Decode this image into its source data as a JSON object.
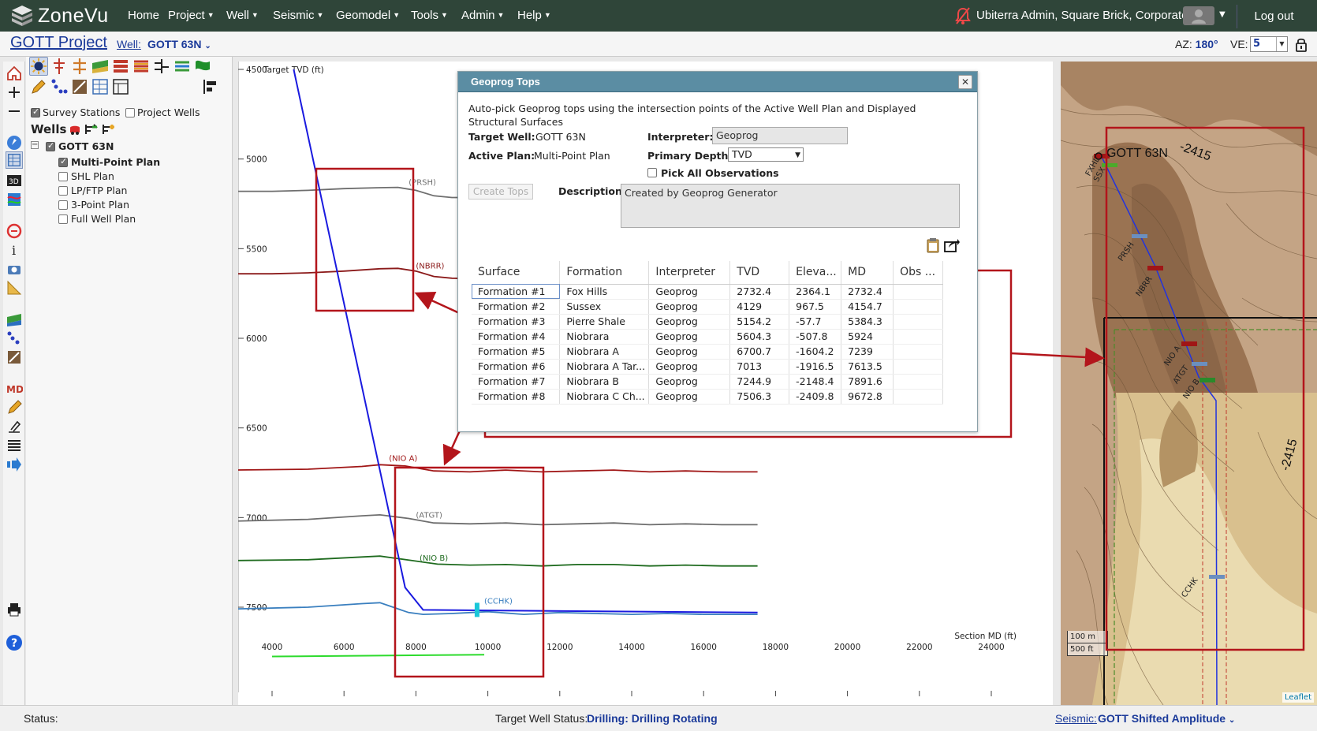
{
  "app": {
    "logo_text": "ZoneVu",
    "nav": [
      {
        "label": "Home",
        "has_menu": false
      },
      {
        "label": "Project",
        "has_menu": true
      },
      {
        "label": "Well",
        "has_menu": true
      },
      {
        "label": "Seismic",
        "has_menu": true
      },
      {
        "label": "Geomodel",
        "has_menu": true
      },
      {
        "label": "Tools",
        "has_menu": true
      },
      {
        "label": "Admin",
        "has_menu": true
      },
      {
        "label": "Help",
        "has_menu": true
      }
    ],
    "user": "Ubiterra Admin, Square Brick, Corporate",
    "logout": "Log out"
  },
  "project_bar": {
    "title": "GOTT Project",
    "well_label": "Well:",
    "well_value": "GOTT 63N",
    "az_label": "AZ:",
    "az_value": "180°",
    "ve_label": "VE:",
    "ve_value": "5"
  },
  "left_panel": {
    "survey_stations": {
      "label": "Survey Stations",
      "checked": true
    },
    "project_wells": {
      "label": "Project Wells",
      "checked": false
    },
    "wells_heading": "Wells",
    "tree": {
      "well": {
        "label": "GOTT 63N",
        "checked": true
      },
      "plans": [
        {
          "label": "Multi-Point Plan",
          "checked": true,
          "bold": true
        },
        {
          "label": "SHL Plan",
          "checked": false,
          "bold": false
        },
        {
          "label": "LP/FTP Plan",
          "checked": false,
          "bold": false
        },
        {
          "label": "3-Point Plan",
          "checked": false,
          "bold": false
        },
        {
          "label": "Full Well Plan",
          "checked": false,
          "bold": false
        }
      ]
    }
  },
  "icons": {
    "iconbar": [
      "home-icon",
      "zoom-in-icon",
      "zoom-out-icon",
      "compass-icon",
      "section-view-icon",
      "3d-view-icon",
      "seismic-icon",
      "log-icon",
      "info-icon",
      "camera-icon",
      "ruler-icon",
      "horizon-icon",
      "tops-icon",
      "geosteer-icon",
      "md-icon",
      "pencil-icon",
      "annotate-icon",
      "list-icon",
      "export-arrow-icon",
      "print-icon",
      "help-icon"
    ]
  },
  "chart_data": {
    "type": "line",
    "ylabel": "Target TVD (ft)",
    "xlabel": "Section MD (ft)",
    "y_ticks": [
      4500,
      5000,
      5500,
      6000,
      6500,
      7000,
      7500
    ],
    "x_ticks": [
      4000,
      6000,
      8000,
      10000,
      12000,
      14000,
      16000,
      18000,
      20000,
      22000,
      24000
    ],
    "xlim": [
      2900,
      25500
    ],
    "ylim": [
      4500,
      7700
    ],
    "y_reversed": true,
    "grid": false,
    "surfaces": [
      {
        "name": "(PRSH)",
        "color": "#6e6e6e",
        "label_x": 7800,
        "label_tvd": 5145,
        "x": [
          2900,
          4000,
          5000,
          6000,
          7000,
          7500,
          8000,
          8500,
          9000,
          9900
        ],
        "tvd": [
          5180,
          5180,
          5175,
          5165,
          5160,
          5158,
          5175,
          5205,
          5215,
          5215
        ]
      },
      {
        "name": "(NBRR)",
        "color": "#8b1a1a",
        "label_x": 8000,
        "label_tvd": 5610,
        "x": [
          2900,
          4000,
          5000,
          6000,
          7000,
          7500,
          8000,
          8500,
          9000,
          9900
        ],
        "tvd": [
          5640,
          5640,
          5635,
          5625,
          5612,
          5610,
          5625,
          5655,
          5665,
          5668
        ]
      },
      {
        "name": "(NIO A)",
        "color": "#a01616",
        "label_x": 7250,
        "label_tvd": 6685,
        "x": [
          2900,
          5000,
          6500,
          7000,
          7700,
          8500,
          9500,
          10500,
          11500,
          12500,
          13500,
          14500,
          15500,
          16500,
          17500
        ],
        "tvd": [
          6735,
          6730,
          6715,
          6705,
          6712,
          6740,
          6745,
          6735,
          6745,
          6740,
          6735,
          6745,
          6740,
          6745,
          6745
        ]
      },
      {
        "name": "(ATGT)",
        "color": "#6e6e6e",
        "label_x": 8000,
        "label_tvd": 7000,
        "x": [
          2900,
          5000,
          6500,
          7000,
          7800,
          8500,
          9500,
          10500,
          11500,
          12500,
          13500,
          14500,
          15500,
          16500,
          17500
        ],
        "tvd": [
          7020,
          7010,
          6990,
          6985,
          7005,
          7030,
          7035,
          7030,
          7040,
          7035,
          7030,
          7040,
          7035,
          7040,
          7040
        ]
      },
      {
        "name": "(NIO B)",
        "color": "#1f6b1f",
        "label_x": 8100,
        "label_tvd": 7240,
        "x": [
          2900,
          5000,
          6500,
          7000,
          7900,
          8600,
          9500,
          10500,
          11500,
          12500,
          13500,
          14500,
          15500,
          16500,
          17500
        ],
        "tvd": [
          7240,
          7235,
          7220,
          7215,
          7240,
          7260,
          7265,
          7262,
          7270,
          7262,
          7262,
          7270,
          7265,
          7270,
          7270
        ]
      },
      {
        "name": "(CCHK)",
        "color": "#3a7fbf",
        "label_x": 9900,
        "label_tvd": 7480,
        "x": [
          2900,
          5000,
          6500,
          7000,
          7800,
          8200,
          9000,
          10000,
          11000,
          12000,
          13000,
          14000,
          15000,
          16000,
          17500
        ],
        "tvd": [
          7510,
          7500,
          7480,
          7475,
          7530,
          7540,
          7535,
          7525,
          7540,
          7530,
          7535,
          7540,
          7535,
          7540,
          7540
        ]
      }
    ],
    "well_path": {
      "color": "#1a1adf",
      "x": [
        4600,
        7700,
        8200,
        17500
      ],
      "tvd": [
        4500,
        7390,
        7515,
        7530
      ]
    },
    "active_marker": {
      "x": 9700,
      "tvd": 7515
    },
    "green_line": {
      "x": [
        4000,
        9900
      ],
      "tvd": [
        7775,
        7765
      ]
    }
  },
  "dialog": {
    "title": "Geoprog Tops",
    "description_text": "Auto-pick Geoprog tops using the intersection points of the Active Well Plan and Displayed Structural Surfaces",
    "target_well_label": "Target Well:",
    "target_well_value": "GOTT 63N",
    "active_plan_label": "Active Plan:",
    "active_plan_value": "Multi-Point Plan",
    "interpreter_label": "Interpreter:",
    "interpreter_value": "Geoprog",
    "primary_depth_label": "Primary Depth:",
    "primary_depth_value": "TVD",
    "pick_all_label": "Pick All Observations",
    "create_tops": "Create Tops",
    "description_label": "Description:",
    "description_value": "Created by Geoprog Generator",
    "table": {
      "columns": [
        "Surface",
        "Formation",
        "Interpreter",
        "TVD",
        "Eleva...",
        "MD",
        "Obs ..."
      ],
      "rows": [
        [
          "Formation #1",
          "Fox Hills",
          "Geoprog",
          "2732.4",
          "2364.1",
          "2732.4",
          ""
        ],
        [
          "Formation #2",
          "Sussex",
          "Geoprog",
          "4129",
          "967.5",
          "4154.7",
          ""
        ],
        [
          "Formation #3",
          "Pierre Shale",
          "Geoprog",
          "5154.2",
          "-57.7",
          "5384.3",
          ""
        ],
        [
          "Formation #4",
          "Niobrara",
          "Geoprog",
          "5604.3",
          "-507.8",
          "5924",
          ""
        ],
        [
          "Formation #5",
          "Niobrara A",
          "Geoprog",
          "6700.7",
          "-1604.2",
          "7239",
          ""
        ],
        [
          "Formation #6",
          "Niobrara A Tar...",
          "Geoprog",
          "7013",
          "-1916.5",
          "7613.5",
          ""
        ],
        [
          "Formation #7",
          "Niobrara B",
          "Geoprog",
          "7244.9",
          "-2148.4",
          "7891.6",
          ""
        ],
        [
          "Formation #8",
          "Niobrara C Ch...",
          "Geoprog",
          "7506.3",
          "-2409.8",
          "9672.8",
          ""
        ]
      ]
    }
  },
  "map": {
    "well_label": "GOTT 63N",
    "contour_label_top": "-2415",
    "contour_label_right": "-2415",
    "tops": [
      "FXHL",
      "SSX",
      "PRSH",
      "NBRR",
      "NIO A",
      "ATGT",
      "NIO B",
      "CCHK"
    ],
    "scale_m": "100 m",
    "scale_ft": "500 ft",
    "attribution": "Leaflet"
  },
  "status_bar": {
    "status_label": "Status:",
    "target_label": "Target Well Status:",
    "target_value": "Drilling: Drilling Rotating",
    "seismic_label": "Seismic:",
    "seismic_value": "GOTT Shifted Amplitude"
  },
  "colors": {
    "nav_bg": "#2f4539",
    "dialog_title_bg": "#5b8da3",
    "callout_red": "#b3151b",
    "link_blue": "#1b3a9a"
  }
}
